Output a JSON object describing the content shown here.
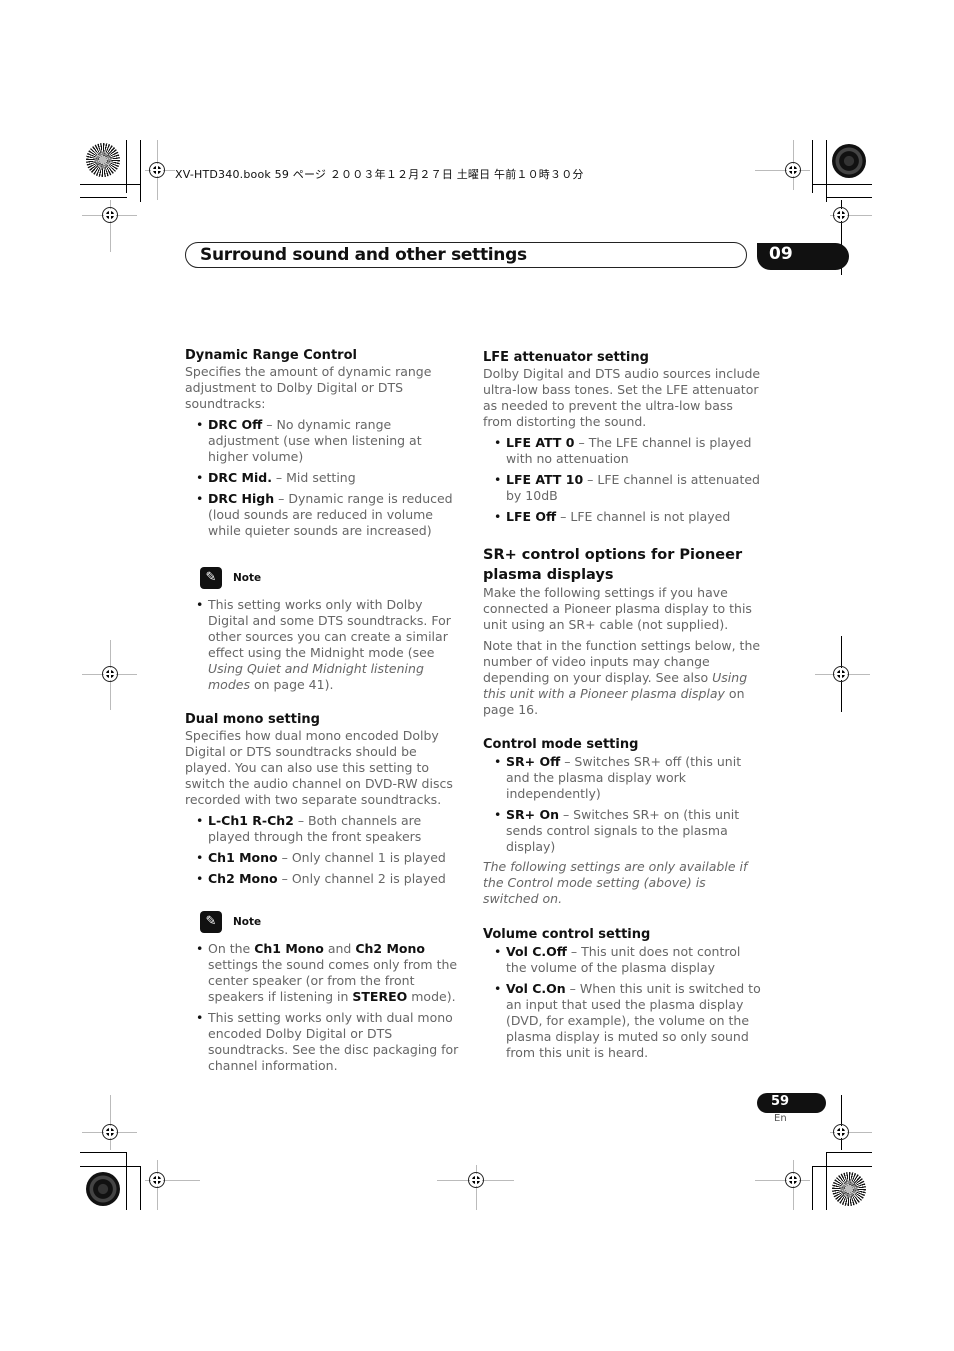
{
  "print_header": "XV-HTD340.book  59 ページ  ２００３年１２月２７日  土曜日  午前１０時３０分",
  "chapter": {
    "title": "Surround sound and other settings",
    "number": "09"
  },
  "left_column": {
    "dynamic_range": {
      "heading": "Dynamic Range Control",
      "intro": "Specifies the amount of dynamic range adjustment to Dolby Digital or DTS soundtracks:",
      "items": [
        {
          "term": "DRC Off",
          "desc": " – No dynamic range adjustment (use when listening at higher volume)"
        },
        {
          "term": "DRC Mid.",
          "desc": " – Mid setting"
        },
        {
          "term": "DRC High",
          "desc": " – Dynamic range is reduced (loud sounds are reduced in volume while quieter sounds are increased)"
        }
      ]
    },
    "note1": {
      "label": "Note",
      "text_pre": "This setting works only with Dolby Digital and some DTS soundtracks. For other sources you can create a similar effect using the Midnight mode (see ",
      "text_italic": "Using Quiet and Midnight listening modes",
      "text_post": " on page 41)."
    },
    "dual_mono": {
      "heading": "Dual mono setting",
      "intro": "Specifies how dual mono encoded Dolby Digital or DTS soundtracks should be played. You can also use this setting to switch the audio channel on DVD-RW discs recorded with two separate soundtracks.",
      "items": [
        {
          "term": "L-Ch1 R-Ch2",
          "desc": " – Both channels are played through the front speakers"
        },
        {
          "term": "Ch1 Mono",
          "desc": " – Only channel 1 is played"
        },
        {
          "term": "Ch2 Mono",
          "desc": " – Only channel 2 is played"
        }
      ]
    },
    "note2": {
      "label": "Note",
      "b1_a": "On the ",
      "b1_b": "Ch1 Mono",
      "b1_c": " and ",
      "b1_d": "Ch2 Mono",
      "b1_e": " settings the sound comes only from the center speaker (or from the front speakers if listening in ",
      "b1_f": "STEREO",
      "b1_g": " mode).",
      "b2": "This setting works only with dual mono encoded Dolby Digital or DTS soundtracks. See the disc packaging for channel information."
    }
  },
  "right_column": {
    "lfe": {
      "heading": "LFE attenuator setting",
      "intro": "Dolby Digital and DTS audio sources include ultra-low bass tones. Set the LFE attenuator as needed to prevent the ultra-low bass from distorting the sound.",
      "items": [
        {
          "term": "LFE ATT 0",
          "desc": " – The LFE channel is played with no attenuation"
        },
        {
          "term": "LFE ATT 10",
          "desc": " – LFE channel is attenuated by 10dB"
        },
        {
          "term": "LFE Off",
          "desc": " – LFE channel is not played"
        }
      ]
    },
    "sr": {
      "heading": "SR+ control options for Pioneer plasma displays",
      "p1": "Make the following settings if you have connected a Pioneer plasma display to this unit using an SR+ cable (not supplied).",
      "p2_pre": "Note that in the function settings below, the number of video inputs may change depending on your display. See also ",
      "p2_italic": "Using this unit with a Pioneer plasma display",
      "p2_post": " on page 16."
    },
    "control_mode": {
      "heading": "Control mode setting",
      "items": [
        {
          "term": "SR+ Off",
          "desc": " – Switches SR+ off (this unit and the plasma display work independently)"
        },
        {
          "term": "SR+ On",
          "desc": " – Switches SR+ on (this unit sends control signals to the plasma display)"
        }
      ],
      "italic_note": "The following settings are only available if the Control mode setting (above) is switched on."
    },
    "volume": {
      "heading": "Volume control setting",
      "items": [
        {
          "term": "Vol C.Off",
          "desc": " – This unit does not control the volume of the plasma display"
        },
        {
          "term": "Vol C.On",
          "desc": " – When this unit is switched to an input that used the plasma display (DVD, for example), the volume on the plasma display is muted so only sound from this unit is heard."
        }
      ]
    }
  },
  "footer": {
    "page_number": "59",
    "language": "En"
  },
  "icons": {
    "note_icon": "pencil-icon"
  }
}
